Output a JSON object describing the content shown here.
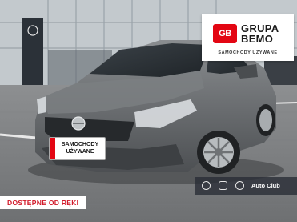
{
  "logo": {
    "badge": "GB",
    "line1": "GRUPA",
    "line2": "BEMO",
    "tagline": "SAMOCHODY UŻYWANE"
  },
  "plate": {
    "line1": "SAMOCHODY",
    "line2": "UŻYWANE"
  },
  "badge": {
    "label": "DOSTĘPNE OD RĘKI"
  },
  "club": {
    "label": "Auto Club",
    "icons": [
      "opel-brand-icon",
      "dealer-brand-icon",
      "peugeot-brand-icon"
    ]
  },
  "colors": {
    "brand_red": "#e30613",
    "car_body": "#6f7275",
    "badge_text": "#d21a2a"
  }
}
